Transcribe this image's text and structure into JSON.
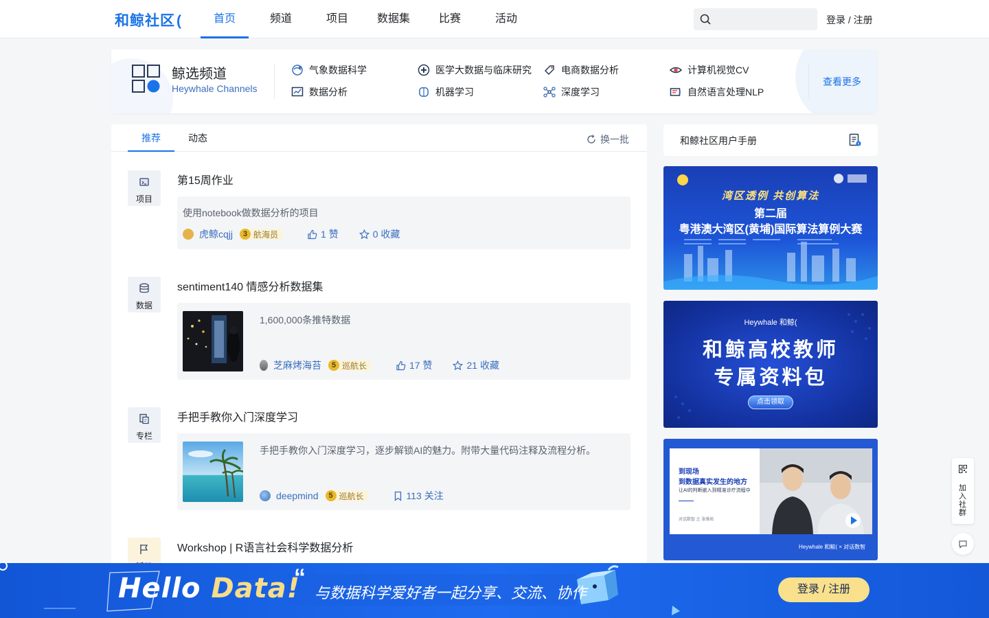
{
  "header": {
    "logo": "和鲸社区",
    "logo_mark": "(",
    "nav": [
      "首页",
      "频道",
      "项目",
      "数据集",
      "比赛",
      "活动"
    ],
    "search_placeholder": "",
    "login": "登录 / 注册"
  },
  "channels": {
    "title": "鲸选频道",
    "subtitle": "Heywhale Channels",
    "items": [
      "气象数据科学",
      "医学大数据与临床研究",
      "电商数据分析",
      "计算机视觉CV",
      "数据分析",
      "机器学习",
      "深度学习",
      "自然语言处理NLP"
    ],
    "more": "查看更多"
  },
  "feed": {
    "tabs": [
      "推荐",
      "动态"
    ],
    "refresh": "换一批",
    "items": [
      {
        "type": "项目",
        "title": "第15周作业",
        "desc": "使用notebook做数据分析的项目",
        "author": "虎鲸cqjj",
        "level_num": "3",
        "level": "航海员",
        "likes": "1 赞",
        "favs": "0 收藏"
      },
      {
        "type": "数据",
        "title": "sentiment140 情感分析数据集",
        "desc": "1,600,000条推特数据",
        "author": "芝麻烤海苔",
        "level_num": "5",
        "level": "巡航长",
        "likes": "17 赞",
        "favs": "21 收藏"
      },
      {
        "type": "专栏",
        "title": "手把手教你入门深度学习",
        "desc": "手把手教你入门深度学习，逐步解锁AI的魅力。附带大量代码注释及流程分析。",
        "author": "deepmind",
        "level_num": "5",
        "level": "巡航长",
        "follows": "113 关注"
      },
      {
        "type": "活动",
        "title": "Workshop | R语言社会科学数据分析"
      }
    ]
  },
  "sidebar": {
    "handbook": "和鲸社区用户手册",
    "banner1": {
      "line1": "湾区透例  共创算法",
      "line2": "第二届",
      "line3": "粤港澳大湾区(黄埔)国际算法算例大赛"
    },
    "banner2": {
      "brand": "Heywhale 和鲸(",
      "line1": "和鲸高校教师",
      "line2": "专属资料包",
      "button": "点击领取"
    },
    "banner3": {
      "line1": "到现场",
      "line2": "到数据真实发生的地方",
      "line3": "让AI的判断嵌入到精准诊疗流程中",
      "caption": "对话数智 之 张维拓",
      "brand": "Heywhale 和鲸(  ×  对话数智"
    }
  },
  "floating": {
    "join": "加入社群"
  },
  "bottom_bar": {
    "hello_1": "Hello ",
    "hello_2": "Data!",
    "slogan": "与数据科学爱好者一起分享、交流、协作",
    "login": "登录 / 注册"
  },
  "colors": {
    "accent": "#1a73e8",
    "level_gold": "#e8b92e",
    "bottom_bar": "#1e6bf0"
  }
}
